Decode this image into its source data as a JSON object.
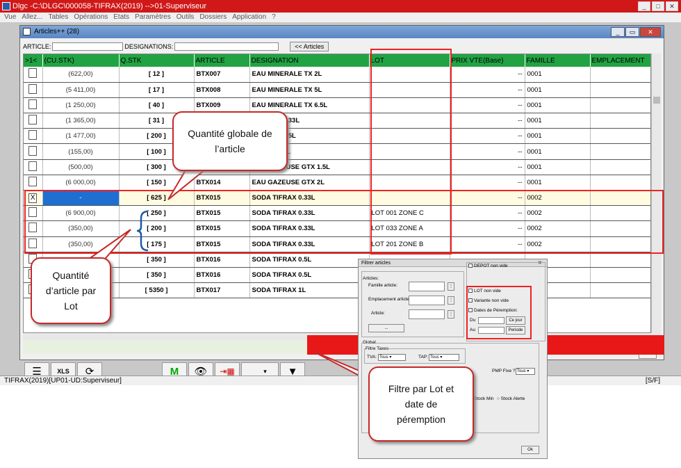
{
  "app": {
    "title": "Dlgc -C:\\DLGC\\000058-TIFRAX(2019) -->01-Superviseur",
    "menu": [
      "Vue",
      "Allez...",
      "Tables",
      "Opérations",
      "Etats",
      "Paramètres",
      "Outils",
      "Dossiers",
      "Application",
      "?"
    ],
    "status_left": "TIFRAX(2019)[UP01-UD:Superviseur]",
    "status_right": "[S/F]"
  },
  "window": {
    "title": "Articles++ (28)",
    "filter": {
      "article_label": "ARTICLE:",
      "designation_label": "DESIGNATIONS:",
      "articles_button": "<< Articles"
    },
    "columns": [
      ">1<",
      "(CU.STK)",
      "Q.STK",
      "ARTICLE",
      "DESIGNATION",
      "LOT",
      "PRIX VTE(Base)",
      "FAMILLE",
      "EMPLACEMENT"
    ],
    "rows": [
      {
        "check": "",
        "cu": "(622,00)",
        "qstk": "[ 12 ]",
        "article": "BTX007",
        "designation": "EAU MINERALE TX 2L",
        "lot": "",
        "prix": "--",
        "famille": "0001"
      },
      {
        "check": "",
        "cu": "(5 411,00)",
        "qstk": "[ 17 ]",
        "article": "BTX008",
        "designation": "EAU MINERALE TX 5L",
        "lot": "",
        "prix": "--",
        "famille": "0001"
      },
      {
        "check": "",
        "cu": "(1 250,00)",
        "qstk": "[ 40 ]",
        "article": "BTX009",
        "designation": "EAU MINERALE TX 6.5L",
        "lot": "",
        "prix": "--",
        "famille": "0001"
      },
      {
        "check": "",
        "cu": "(1 365,00)",
        "qstk": "[ 31 ]",
        "article": "",
        "designation": "USE GTX 0.33L",
        "lot": "",
        "prix": "--",
        "famille": "0001"
      },
      {
        "check": "",
        "cu": "(1 477,00)",
        "qstk": "[ 200 ]",
        "article": "",
        "designation": "USE GTX 0.5L",
        "lot": "",
        "prix": "--",
        "famille": "0001"
      },
      {
        "check": "",
        "cu": "(155,00)",
        "qstk": "[ 100 ]",
        "article": "",
        "designation": "USE GTX 1L",
        "lot": "",
        "prix": "--",
        "famille": "0001"
      },
      {
        "check": "",
        "cu": "(500,00)",
        "qstk": "[ 300 ]",
        "article": "013",
        "designation": "EAU GAZEUSE GTX 1.5L",
        "lot": "",
        "prix": "--",
        "famille": "0001"
      },
      {
        "check": "",
        "cu": "(6 000,00)",
        "qstk": "[ 150 ]",
        "article": "BTX014",
        "designation": "EAU GAZEUSE GTX  2L",
        "lot": "",
        "prix": "--",
        "famille": "0001"
      },
      {
        "check": "X",
        "cu": "-",
        "qstk": "[ 625 ]",
        "article": "BTX015",
        "designation": "SODA TIFRAX 0.33L",
        "lot": "",
        "prix": "--",
        "famille": "0002"
      },
      {
        "check": "",
        "cu": "(6 900,00)",
        "qstk": "[ 250 ]",
        "article": "BTX015",
        "designation": "SODA TIFRAX 0.33L",
        "lot": "LOT 001 ZONE C",
        "prix": "--",
        "famille": "0002"
      },
      {
        "check": "",
        "cu": "(350,00)",
        "qstk": "[ 200 ]",
        "article": "BTX015",
        "designation": "SODA TIFRAX 0.33L",
        "lot": "LOT 033 ZONE A",
        "prix": "--",
        "famille": "0002"
      },
      {
        "check": "",
        "cu": "(350,00)",
        "qstk": "[ 175 ]",
        "article": "BTX015",
        "designation": "SODA TIFRAX 0.33L",
        "lot": "LOT 201 ZONE B",
        "prix": "--",
        "famille": "0002"
      },
      {
        "check": "",
        "cu": "",
        "qstk": "[ 350 ]",
        "article": "BTX016",
        "designation": "SODA TIFRAX 0.5L",
        "lot": "",
        "prix": "",
        "famille": ""
      },
      {
        "check": "",
        "cu": "",
        "qstk": "[ 350 ]",
        "article": "BTX016",
        "designation": "SODA TIFRAX 0.5L",
        "lot": "",
        "prix": "",
        "famille": ""
      },
      {
        "check": "",
        "cu": "",
        "qstk": "[ 5350 ]",
        "article": "BTX017",
        "designation": "SODA TIFRAX 1L",
        "lot": "",
        "prix": "",
        "famille": ""
      }
    ]
  },
  "callouts": {
    "global_qty": "Quantité globale de l’article",
    "lot_qty": "Quantité d’article par Lot",
    "filter_lot": "Filtre par Lot et date de péremption"
  },
  "dialog": {
    "title": "Filtrer articles",
    "articles_group": "Articles:",
    "famille": "Famille article:",
    "emplacement": "Emplacement article:",
    "article": "Article:",
    "depot_non_vide": "DEPOT non vide",
    "lot_non_vide": "LOT non vide",
    "variante_non_vide": "Variante non vide",
    "dates_peremption": "Dates de Péremption:",
    "du": "Du",
    "au": "Au",
    "ce_jour": "Ce jour",
    "periode": "Periode",
    "global": "Global",
    "filtre_taxes": "Filtre Taxes",
    "tva": "TVA:",
    "tap": "TAP:",
    "tous": "Tous",
    "pmp_fixe": "PMP Fixe ?",
    "stock_min": "Stock Min",
    "stock_alerte": "Stock Alerte",
    "ok": "Ok"
  },
  "colors": {
    "header_green": "#21a343",
    "red": "#e81818",
    "selection_blue": "#1f6fd2"
  }
}
